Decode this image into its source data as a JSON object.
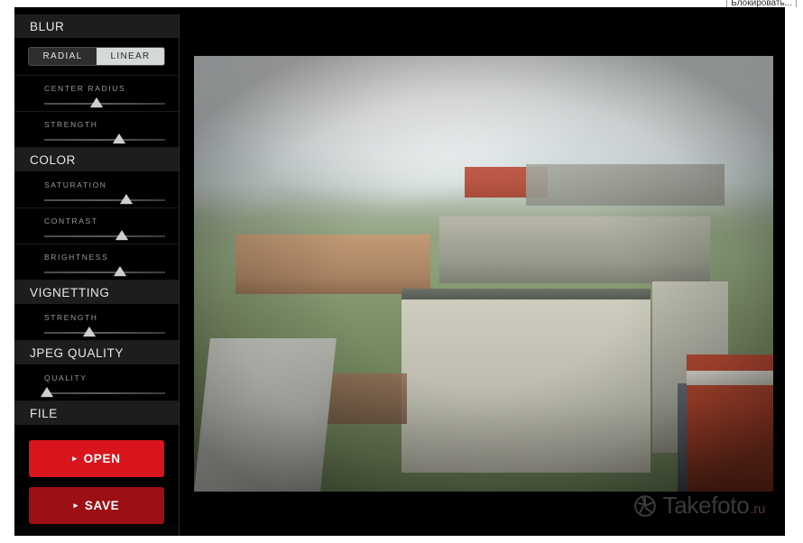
{
  "browser": {
    "plugin_chip_label": "Блокировать..."
  },
  "app": {
    "name": "photo-editor",
    "accent_open": "#d8141c",
    "accent_save": "#9c0f14",
    "panel_bg": "#050505",
    "header_bg": "#1d1d1d"
  },
  "sidebar": {
    "sections": [
      {
        "id": "blur",
        "title": "BLUR",
        "toggle": {
          "options": [
            "RADIAL",
            "LINEAR"
          ],
          "selected": "LINEAR"
        },
        "sliders": [
          {
            "label": "CENTER RADIUS",
            "value": 43
          },
          {
            "label": "STRENGTH",
            "value": 62
          }
        ]
      },
      {
        "id": "color",
        "title": "COLOR",
        "sliders": [
          {
            "label": "SATURATION",
            "value": 68
          },
          {
            "label": "CONTRAST",
            "value": 64
          },
          {
            "label": "BRIGHTNESS",
            "value": 63
          }
        ]
      },
      {
        "id": "vignetting",
        "title": "VIGNETTING",
        "sliders": [
          {
            "label": "STRENGTH",
            "value": 37
          }
        ]
      },
      {
        "id": "jpeg-quality",
        "title": "JPEG QUALITY",
        "sliders": [
          {
            "label": "QUALITY",
            "value": 2
          }
        ]
      },
      {
        "id": "file",
        "title": "FILE",
        "buttons": [
          {
            "id": "open",
            "label": "OPEN",
            "caret": "▸"
          },
          {
            "id": "save",
            "label": "SAVE",
            "caret": "▸"
          }
        ]
      }
    ]
  },
  "canvas": {
    "photo_description": "Aerial cityscape photograph, hazy bright sky, rows of apartment blocks, concrete ledge at lower left and red brick wall at lower right",
    "zoom_fit": true
  },
  "watermark": {
    "icon": "aperture-icon",
    "text": "Takefoto",
    "suffix": ".ru"
  }
}
